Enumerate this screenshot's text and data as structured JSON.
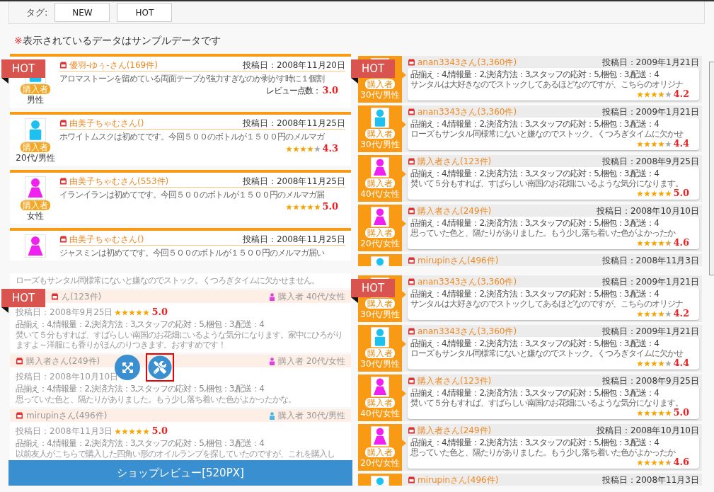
{
  "tag_filter": {
    "label": "タグ:",
    "tags": [
      {
        "label": "NEW",
        "selected": false
      },
      {
        "label": "HOT",
        "selected": false
      }
    ]
  },
  "notice": {
    "mark": "※",
    "text": "表示されているデータはサンプルデータです"
  },
  "templates": [
    {
      "kind": "card",
      "ribbon": "HOT",
      "reviews": [
        {
          "kind": "male",
          "name": "優羽-ゆぅ-さん(169件)",
          "date": "投稿日：2008年11月20日",
          "text": "アロマストーンを留めている両面テープが強力すぎなのか剥がす時に１個割",
          "score_label": "レビュー点数：",
          "score": "3.0",
          "buyer": "購入者",
          "gender": "男性"
        },
        {
          "kind": "male",
          "name": "由美子ちゃむさん()",
          "date": "投稿日：2008年11月25日",
          "text": "ホワイトムスクは初めてです。今回５００のボトルが１５００円のメルマガ",
          "stars": 4,
          "score": "4.3",
          "buyer": "購入者",
          "gender": "20代/男性"
        },
        {
          "kind": "female",
          "name": "由美子ちゃむさん(553件)",
          "date": "投稿日：2008年11月25日",
          "text": "イランイランは初めてです。今回５００のボトルが１５００円のメルマガ届",
          "stars": 5,
          "score": "5.0",
          "buyer": "購入者",
          "gender": "女性"
        },
        {
          "kind": "female",
          "name": "由美子ちゃむさん()",
          "date": "投稿日：2008年11月25日",
          "text": "ジャスミンは初めてです。今回５００のボトルが１５００円のメルマガ届い"
        }
      ]
    },
    {
      "kind": "bubble",
      "ribbon": "HOT",
      "reviews": [
        {
          "kind": "male",
          "name": "anan3343さん(3,360件)",
          "date": "投稿日：2009年1月21日",
          "attrs": "品揃え：4,情報量：2,決済方法：3,スタッフの応対：5,梱包：3,配送：4",
          "text": "サンタルは大好きなのでストックしてあるほどなのですが、こちらのオリジナ",
          "stars": 4,
          "score": "4.2",
          "buyer": "購入者",
          "gender": "30代/男性"
        },
        {
          "kind": "male",
          "name": "anan3343さん(3,360件)",
          "date": "投稿日：2009年1月21日",
          "attrs": "品揃え：4,情報量：2,決済方法：3,スタッフの応対：5,梱包：3,配送：4",
          "text": "ローズもサンタル同様常にないと嫌なのでストック。くつろぎタイムに欠かせ",
          "stars": 4,
          "score": "4.4",
          "buyer": "購入者",
          "gender": "30代/男性"
        },
        {
          "kind": "female",
          "name": "購入者さん(123件)",
          "date": "投稿日：2008年9月25日",
          "attrs": "品揃え：4,情報量：2,決済方法：3,スタッフの応対：5,梱包：3,配送：4",
          "text": "焚いて５分もすれば、すばらしい南国のお花畑にいるような気分になります。",
          "stars": 5,
          "score": "5.0",
          "buyer": "購入者",
          "gender": "40代/女性"
        },
        {
          "kind": "female",
          "name": "購入者さん(249件)",
          "date": "投稿日：2008年10月10日",
          "attrs": "品揃え：4,情報量：2,決済方法：3,スタッフの応対：5,梱包：3,配送：4",
          "text": "思っていた色と、隔たりがありました。もう少し落ち着いた色がよかったか",
          "stars": 4.5,
          "score": "4.6",
          "buyer": "購入者",
          "gender": "20代/女性"
        },
        {
          "kind": "male",
          "name": "mirupinさん(496件)",
          "date": "投稿日：2008年11月3日"
        }
      ]
    },
    {
      "kind": "list",
      "ribbon": "HOT",
      "caption": "ショップレビュー[520PX]",
      "actions": [
        {
          "kind": "expand",
          "selected": false
        },
        {
          "kind": "tools",
          "selected": true
        }
      ],
      "reviews": [
        {
          "kind": "fragment",
          "text": "ローズもサンタル同様常にないと嫌なのでストック。くつろぎタイムに欠かせません。"
        },
        {
          "kind": "entry",
          "name": "ん(123件)",
          "tag": "購入者 40代/女性",
          "color": "#e040e0",
          "date": "投稿日：2008年9月25日",
          "stars": 5,
          "score": "5.0",
          "attrs": "品揃え：4,情報量：2,決済方法：3,スタッフの応対：5,梱包：3,配送：4",
          "text": "焚いて５分もすれば、すばらしい南国のお花畑にいるような気分になります。家中にひろがりますよ～洋服にも香りがほんのりつきます。おすすめです！"
        },
        {
          "kind": "entry",
          "name": "購入者さん(249件)",
          "tag": "購入者 20代/女性",
          "color": "#e040e0",
          "date": "投稿日：2008年10月10日",
          "attrs": "品揃え：4,情報量：2,決済方法：3,スタッフの応対：5,梱包：3,配送：4",
          "text": "思っていた色と、隔たりがありました。もう少し落ち着いた色がよかったかな。"
        },
        {
          "kind": "entry",
          "name": "mirupinさん(496件)",
          "tag": "購入者 30代/男性",
          "color": "#40b8e8",
          "date": "投稿日：2008年11月3日",
          "stars": 5,
          "score": "5.0",
          "attrs": "品揃え：4,情報量：2,決済方法：3,スタッフの応対：5,梱包：3,配送：4",
          "text": "以前友人がこちらで購入した四角い形のオイルランプを探していたのですが、これを購入し"
        }
      ]
    },
    {
      "kind": "bubble",
      "ribbon": "HOT",
      "reviews": [
        {
          "kind": "male",
          "name": "anan3343さん(3,360件)",
          "date": "投稿日：2009年1月21日",
          "attrs": "品揃え：4,情報量：2,決済方法：3,スタッフの応対：5,梱包：3,配送：4",
          "text": "サンタルは大好きなのでストックしてあるほどなのですが、こちらのオリジナ",
          "stars": 4,
          "score": "4.2",
          "buyer": "購入者",
          "gender": "30代/男性"
        },
        {
          "kind": "male",
          "name": "anan3343さん(3,360件)",
          "date": "投稿日：2009年1月21日",
          "attrs": "品揃え：4,情報量：2,決済方法：3,スタッフの応対：5,梱包：3,配送：4",
          "text": "ローズもサンタル同様常にないと嫌なのでストック。くつろぎタイムに欠かせ",
          "stars": 4,
          "score": "4.4",
          "buyer": "購入者",
          "gender": "30代/男性"
        },
        {
          "kind": "female",
          "name": "購入者さん(123件)",
          "date": "投稿日：2008年9月25日",
          "attrs": "品揃え：4,情報量：2,決済方法：3,スタッフの応対：5,梱包：3,配送：4",
          "text": "焚いて５分もすれば、すばらしい南国のお花畑にいるような気分になります。",
          "stars": 5,
          "score": "5.0",
          "buyer": "購入者",
          "gender": "40代/女性"
        },
        {
          "kind": "female",
          "name": "購入者さん(249件)",
          "date": "投稿日：2008年10月10日",
          "attrs": "品揃え：4,情報量：2,決済方法：3,スタッフの応対：5,梱包：3,配送：4",
          "text": "思っていた色と、隔たりがありました。もう少し落ち着いた色がよかったか",
          "stars": 4.5,
          "score": "4.6",
          "buyer": "購入者",
          "gender": "20代/女性"
        },
        {
          "kind": "male",
          "name": "mirupinさん(496件)",
          "date": "投稿日：2008年11月3日"
        }
      ]
    }
  ]
}
